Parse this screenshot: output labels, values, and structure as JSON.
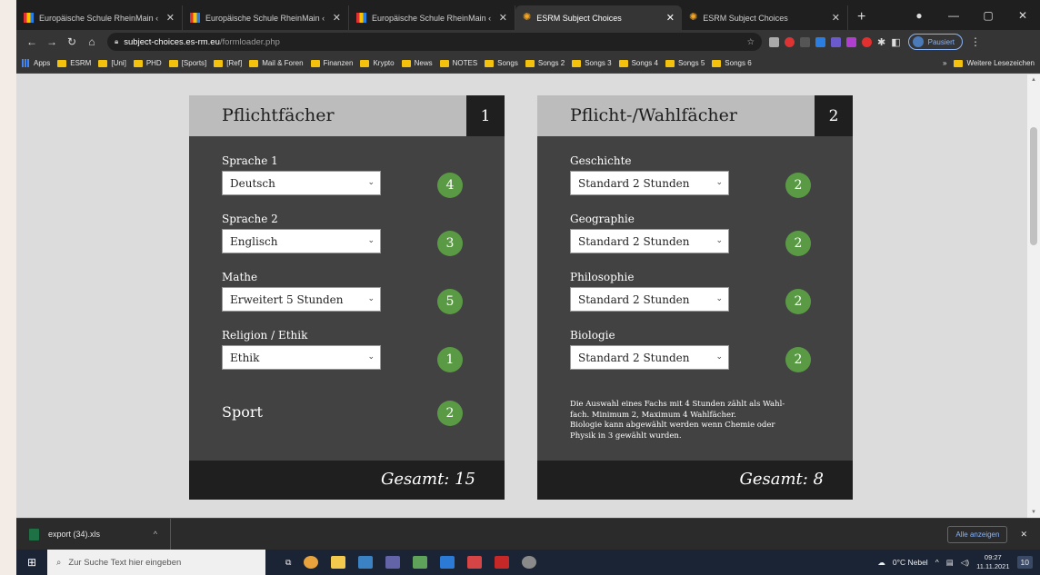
{
  "browser": {
    "tabs": [
      {
        "label": "Europäische Schule RheinMain ‹",
        "active": false
      },
      {
        "label": "Europäische Schule RheinMain ‹",
        "active": false
      },
      {
        "label": "Europäische Schule RheinMain ‹",
        "active": false
      },
      {
        "label": "ESRM Subject Choices",
        "active": true
      },
      {
        "label": "ESRM Subject Choices",
        "active": false
      }
    ],
    "url_host": "subject-choices.es-rm.eu",
    "url_path": "/formloader.php",
    "profile_status": "Pausiert",
    "bookmarks": [
      "Apps",
      "ESRM",
      "[Uni]",
      "PHD",
      "[Sports]",
      "[Ref]",
      "Mail & Foren",
      "Finanzen",
      "Krypto",
      "News",
      "NOTES",
      "Songs",
      "Songs 2",
      "Songs 3",
      "Songs 4",
      "Songs 5",
      "Songs 6"
    ],
    "bookmarks_more": "»",
    "bookmarks_other": "Weitere Lesezeichen"
  },
  "card1": {
    "title": "Pflichtfächer",
    "number": "1",
    "fields": [
      {
        "label": "Sprache 1",
        "value": "Deutsch",
        "hours": "4"
      },
      {
        "label": "Sprache 2",
        "value": "Englisch",
        "hours": "3"
      },
      {
        "label": "Mathe",
        "value": "Erweitert 5 Stunden",
        "hours": "5"
      },
      {
        "label": "Religion / Ethik",
        "value": "Ethik",
        "hours": "1"
      }
    ],
    "sport_label": "Sport",
    "sport_hours": "2",
    "total": "Gesamt: 15"
  },
  "card2": {
    "title": "Pflicht-/Wahlfächer",
    "number": "2",
    "fields": [
      {
        "label": "Geschichte",
        "value": "Standard 2 Stunden",
        "hours": "2"
      },
      {
        "label": "Geographie",
        "value": "Standard 2 Stunden",
        "hours": "2"
      },
      {
        "label": "Philosophie",
        "value": "Standard 2 Stunden",
        "hours": "2"
      },
      {
        "label": "Biologie",
        "value": "Standard 2 Stunden",
        "hours": "2"
      }
    ],
    "note_lines": [
      "Die Auswahl eines Fachs mit 4 Stunden zählt als Wahl-",
      "fach. Minimum 2, Maximum 4 Wahlfächer.",
      "Biologie kann abgewählt werden wenn Chemie oder",
      "Physik in 3 gewählt wurden."
    ],
    "total": "Gesamt:  8"
  },
  "downloads": {
    "file": "export (34).xls",
    "show_all": "Alle anzeigen"
  },
  "taskbar": {
    "search_placeholder": "Zur Suche Text hier eingeben",
    "weather": "0°C Nebel",
    "time": "09:27",
    "date": "11.11.2021",
    "notifications": "10"
  }
}
